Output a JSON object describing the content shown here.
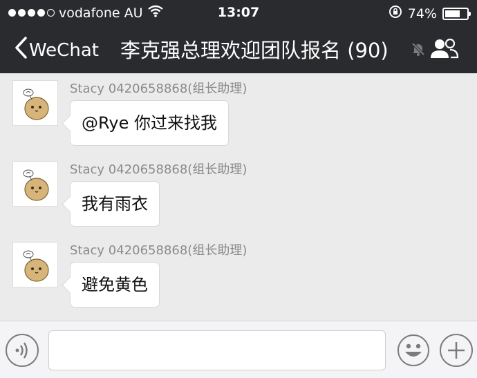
{
  "status_bar": {
    "carrier": "vodafone AU",
    "time": "13:07",
    "battery_percent": "74%",
    "battery_level": 0.74,
    "signal_bars_filled": 4,
    "signal_bars_total": 5
  },
  "nav": {
    "back_label": "WeChat",
    "title": "李克强总理欢迎团队报名 (90)"
  },
  "messages": [
    {
      "sender": "Stacy 0420658868(组长助理)",
      "text": "@Rye 你过来找我"
    },
    {
      "sender": "Stacy 0420658868(组长助理)",
      "text": "我有雨衣"
    },
    {
      "sender": "Stacy 0420658868(组长助理)",
      "text": "避免黄色"
    }
  ],
  "input_bar": {
    "text_value": ""
  },
  "colors": {
    "nav_background": "#2a2b2f",
    "chat_background": "#ebebeb",
    "bubble": "#ffffff",
    "sender_text": "#8a8a8a"
  },
  "icons": [
    "wifi-icon",
    "rotation-lock-icon",
    "battery-icon",
    "back-chevron-icon",
    "mute-icon",
    "group-members-icon",
    "voice-icon",
    "emoji-icon",
    "plus-icon"
  ]
}
